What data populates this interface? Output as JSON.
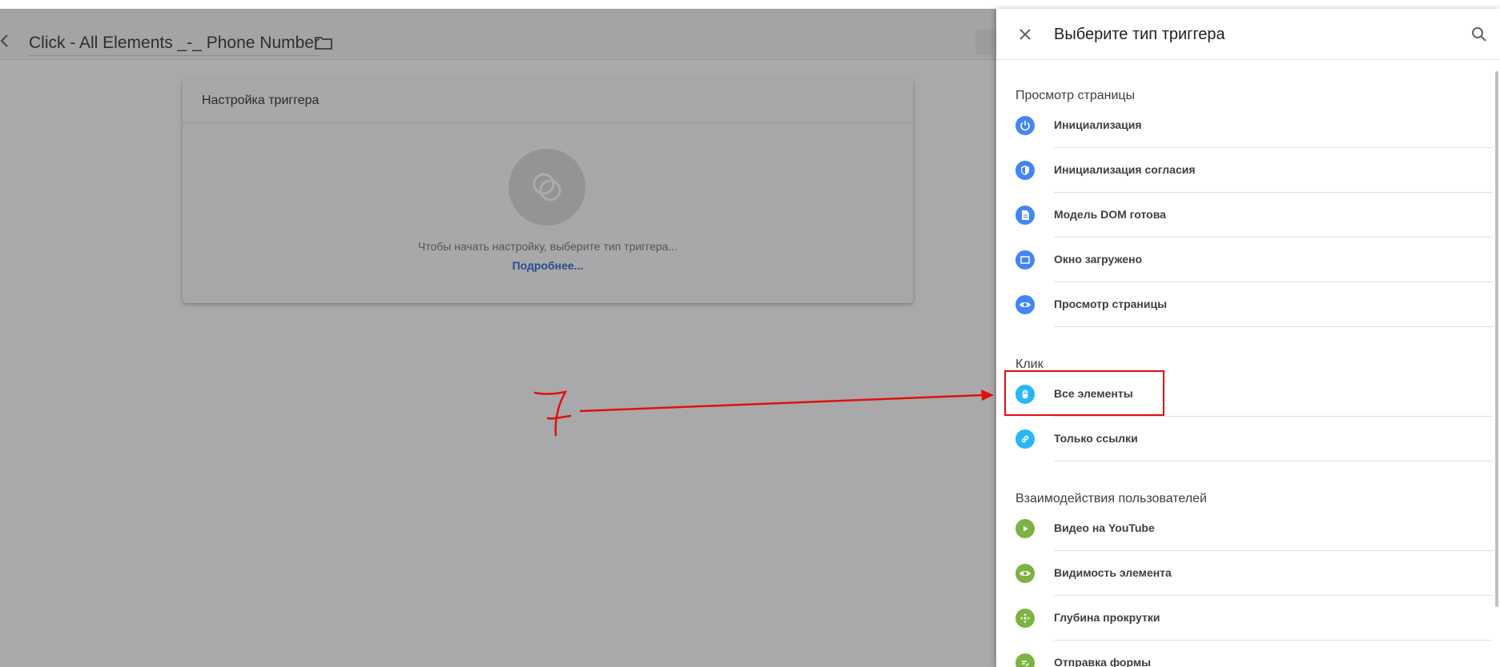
{
  "background": {
    "editor_title": "Click - All Elements _-_ Phone Number",
    "card_title": "Настройка триггера",
    "card_hint": "Чтобы начать настройку, выберите тип триггера...",
    "card_link": "Подробнее..."
  },
  "annotation": {
    "number": "7",
    "color": "#e01010"
  },
  "panel": {
    "title": "Выберите тип триггера",
    "close_icon": "close-icon",
    "search_icon": "search-icon",
    "sections": [
      {
        "title": "Просмотр страницы",
        "items": [
          {
            "label": "Инициализация",
            "icon": "power-icon",
            "color": "#4285f4"
          },
          {
            "label": "Инициализация согласия",
            "icon": "shield-icon",
            "color": "#4285f4"
          },
          {
            "label": "Модель DOM готова",
            "icon": "document-icon",
            "color": "#4285f4"
          },
          {
            "label": "Окно загружено",
            "icon": "window-icon",
            "color": "#4285f4"
          },
          {
            "label": "Просмотр страницы",
            "icon": "eye-icon",
            "color": "#4285f4"
          }
        ]
      },
      {
        "title": "Клик",
        "items": [
          {
            "label": "Все элементы",
            "icon": "mouse-icon",
            "color": "#29b6f6"
          },
          {
            "label": "Только ссылки",
            "icon": "link-icon",
            "color": "#29b6f6"
          }
        ]
      },
      {
        "title": "Взаимодействия пользователей",
        "items": [
          {
            "label": "Видео на YouTube",
            "icon": "play-icon",
            "color": "#7cb342"
          },
          {
            "label": "Видимость элемента",
            "icon": "eye-icon",
            "color": "#7cb342"
          },
          {
            "label": "Глубина прокрутки",
            "icon": "move-arrows-icon",
            "color": "#7cb342"
          },
          {
            "label": "Отправка формы",
            "icon": "form-icon",
            "color": "#7cb342"
          }
        ]
      }
    ]
  }
}
